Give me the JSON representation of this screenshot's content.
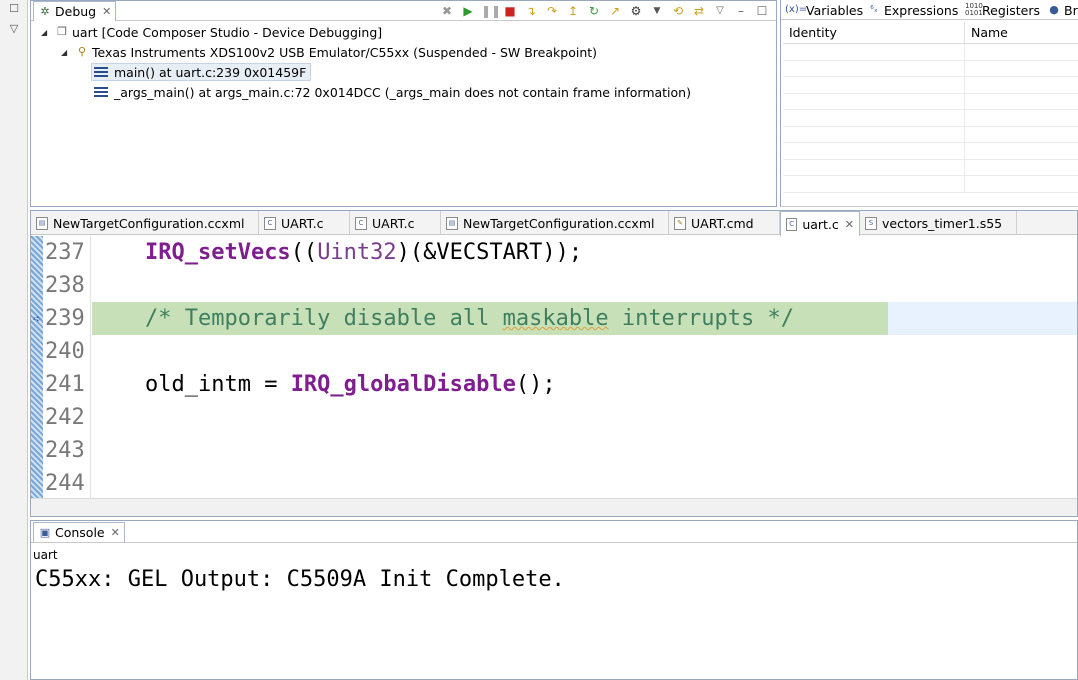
{
  "debug_view": {
    "tab_label": "Debug",
    "tree": [
      {
        "label": "uart [Code Composer Studio - Device Debugging]",
        "expanded": true
      },
      {
        "label": "Texas Instruments XDS100v2 USB Emulator/C55xx (Suspended - SW Breakpoint)",
        "expanded": true
      },
      {
        "label": "main() at uart.c:239 0x01459F",
        "selected": true
      },
      {
        "label": "_args_main() at args_main.c:72 0x014DCC  (_args_main does not contain frame information)"
      }
    ]
  },
  "right_view": {
    "tabs": [
      "Variables",
      "Expressions",
      "Registers",
      "Br"
    ],
    "columns": [
      "Identity",
      "Name"
    ]
  },
  "editor": {
    "tabs": [
      {
        "label": "NewTargetConfiguration.ccxml"
      },
      {
        "label": "UART.c"
      },
      {
        "label": "UART.c"
      },
      {
        "label": "NewTargetConfiguration.ccxml"
      },
      {
        "label": "UART.cmd"
      },
      {
        "label": "uart.c",
        "active": true
      },
      {
        "label": "vectors_timer1.s55"
      }
    ],
    "line_numbers": [
      "237",
      "238",
      "239",
      "240",
      "241",
      "242",
      "243",
      "244"
    ],
    "code": {
      "l237_fn": "IRQ_setVecs",
      "l237_p1": "((",
      "l237_type": "Uint32",
      "l237_p2": ")(&VECSTART));",
      "l239_comment_a": "/* Temporarily disable all ",
      "l239_comment_b": "maskable",
      "l239_comment_c": " interrupts */",
      "l241_a": "old_intm = ",
      "l241_fn": "IRQ_globalDisable",
      "l241_b": "();"
    },
    "current_line": "239",
    "highlight_color": "#c7e0b8"
  },
  "console": {
    "tab_label": "Console",
    "session": "uart",
    "output": "C55xx: GEL Output: C5509A Init Complete."
  }
}
